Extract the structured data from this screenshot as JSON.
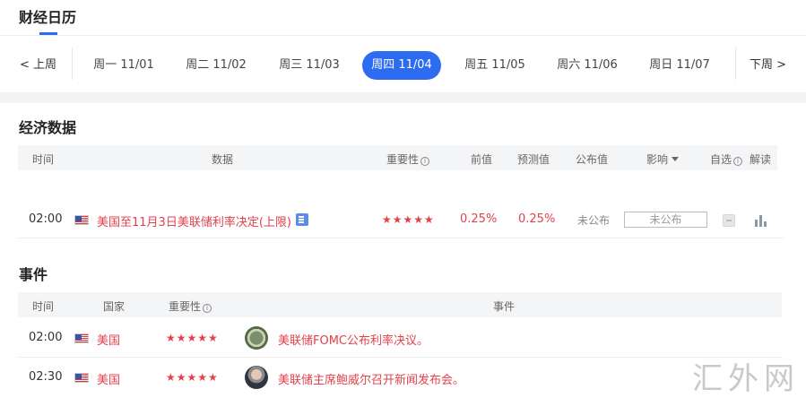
{
  "header": {
    "title": "财经日历"
  },
  "week": {
    "prev_label": "上周",
    "next_label": "下周",
    "days": [
      {
        "label": "周一 11/01",
        "active": false
      },
      {
        "label": "周二 11/02",
        "active": false
      },
      {
        "label": "周三 11/03",
        "active": false
      },
      {
        "label": "周四 11/04",
        "active": true
      },
      {
        "label": "周五 11/05",
        "active": false
      },
      {
        "label": "周六 11/06",
        "active": false
      },
      {
        "label": "周日 11/07",
        "active": false
      }
    ]
  },
  "economic": {
    "title": "经济数据",
    "columns": {
      "time": "时间",
      "data": "数据",
      "importance": "重要性",
      "previous": "前值",
      "forecast": "预测值",
      "actual": "公布值",
      "impact": "影响",
      "watch": "自选",
      "interpret": "解读"
    },
    "rows": [
      {
        "time": "02:00",
        "country_flag": "us-flag-icon",
        "name": "美国至11月3日美联储利率决定(上限)",
        "stars": "★★★★★",
        "previous": "0.25%",
        "forecast": "0.25%",
        "actual": "未公布",
        "impact": "未公布"
      }
    ]
  },
  "events": {
    "title": "事件",
    "columns": {
      "time": "时间",
      "country": "国家",
      "importance": "重要性",
      "event": "事件"
    },
    "rows": [
      {
        "time": "02:00",
        "country": "美国",
        "stars": "★★★★★",
        "text": "美联储FOMC公布利率决议。"
      },
      {
        "time": "02:30",
        "country": "美国",
        "stars": "★★★★★",
        "text": "美联储主席鲍威尔召开新闻发布会。"
      }
    ]
  },
  "watermark": "汇外网",
  "colors": {
    "accent": "#2d6cf0",
    "important": "#e0424b"
  }
}
